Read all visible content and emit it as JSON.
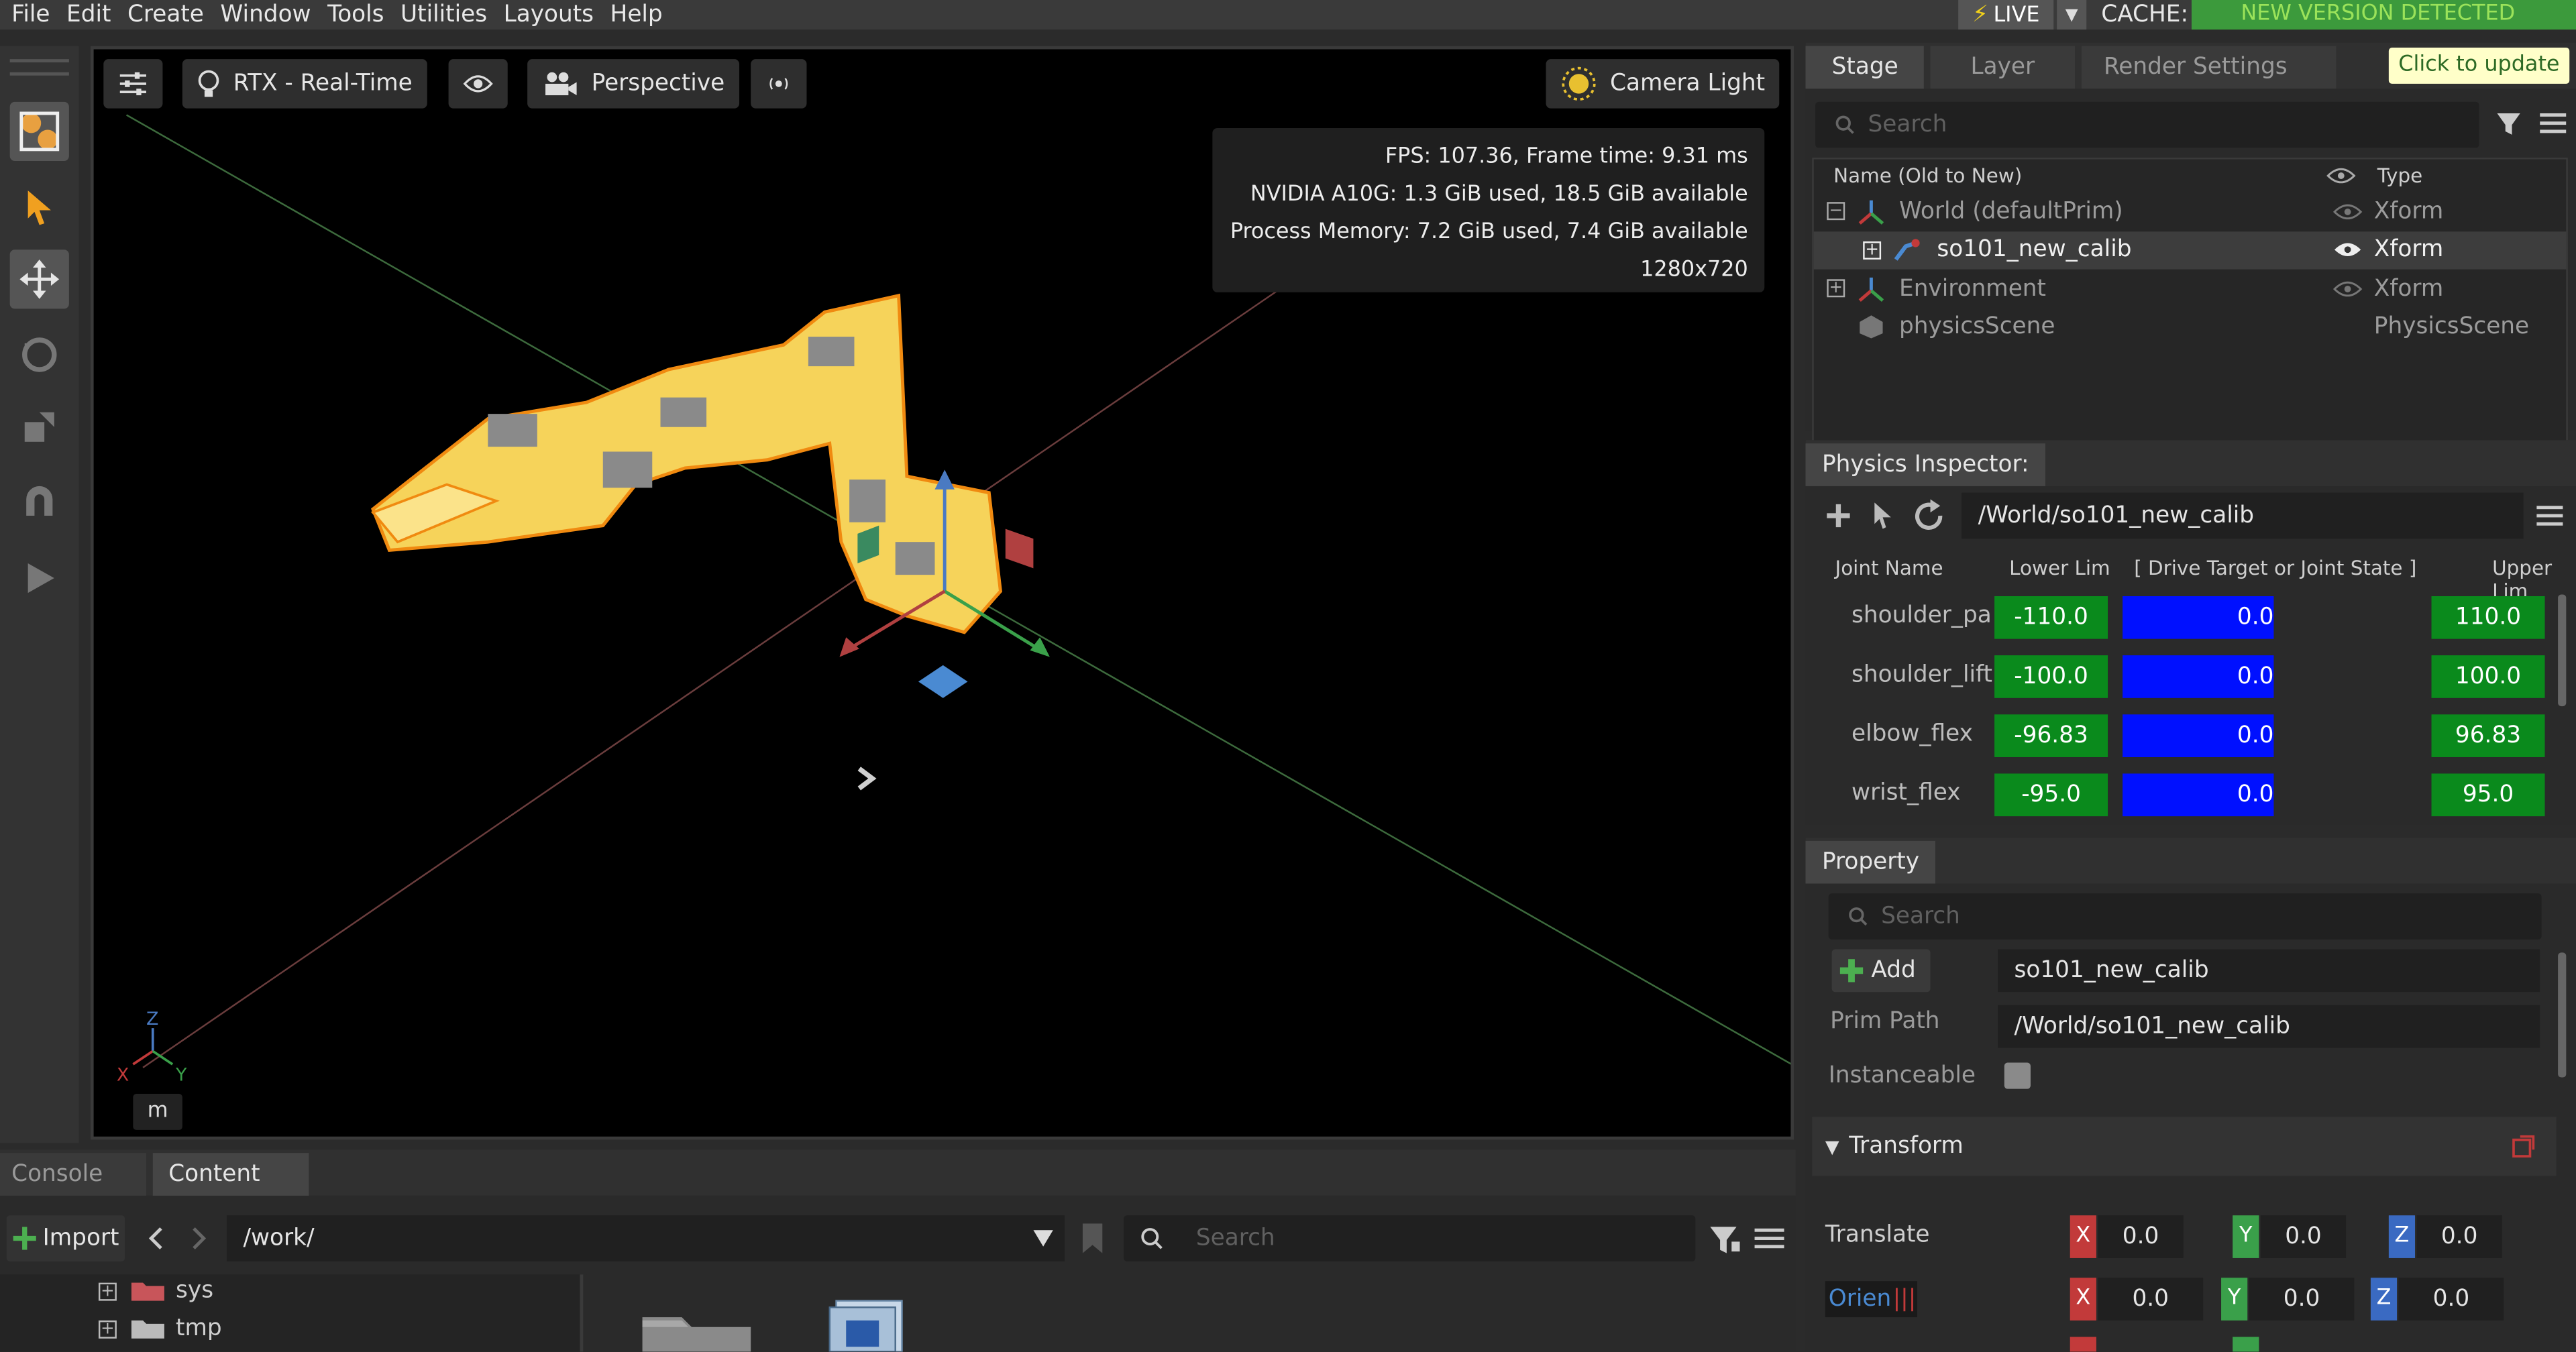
{
  "menu": [
    "File",
    "Edit",
    "Create",
    "Window",
    "Tools",
    "Utilities",
    "Layouts",
    "Help"
  ],
  "live": "LIVE",
  "cache_label": "CACHE:",
  "cache_banner": "NEW VERSION DETECTED",
  "viewport": {
    "render_mode": "RTX - Real-Time",
    "camera": "Perspective",
    "light": "Camera Light",
    "stats": [
      "FPS: 107.36, Frame time: 9.31 ms",
      "NVIDIA A10G: 1.3 GiB used, 18.5 GiB available",
      "Process Memory: 7.2 GiB used, 7.4 GiB available",
      "1280x720"
    ],
    "unit": "m",
    "axis_x": "X",
    "axis_y": "Y",
    "axis_z": "Z"
  },
  "stage": {
    "tabs": [
      "Stage",
      "Layer",
      "Render Settings"
    ],
    "update_btn": "Click to update",
    "search_placeholder": "Search",
    "col_name": "Name (Old to New)",
    "col_type": "Type",
    "rows": [
      {
        "name": "World (defaultPrim)",
        "type": "Xform"
      },
      {
        "name": "so101_new_calib",
        "type": "Xform"
      },
      {
        "name": "Environment",
        "type": "Xform"
      },
      {
        "name": "physicsScene",
        "type": "PhysicsScene"
      }
    ]
  },
  "physics": {
    "title": "Physics Inspector:",
    "path": "/World/so101_new_calib",
    "col_joint": "Joint Name",
    "col_lower": "Lower Lim",
    "col_drive": "[ Drive Target or Joint State ]",
    "col_upper": "Upper Lim",
    "joints": [
      {
        "name": "shoulder_pa",
        "lower": "-110.0",
        "value": "0.0",
        "upper": "110.0"
      },
      {
        "name": "shoulder_lift",
        "lower": "-100.0",
        "value": "0.0",
        "upper": "100.0"
      },
      {
        "name": "elbow_flex",
        "lower": "-96.83",
        "value": "0.0",
        "upper": "96.83"
      },
      {
        "name": "wrist_flex",
        "lower": "-95.0",
        "value": "0.0",
        "upper": "95.0"
      }
    ]
  },
  "property": {
    "tab": "Property",
    "search_placeholder": "Search",
    "add": "Add",
    "name_value": "so101_new_calib",
    "prim_path_label": "Prim Path",
    "prim_path_value": "/World/so101_new_calib",
    "instanceable_label": "Instanceable",
    "transform_label": "Transform",
    "translate_label": "Translate",
    "orient_label": "Orien",
    "translate": [
      "0.0",
      "0.0",
      "0.0"
    ],
    "orient": [
      "0.0",
      "0.0",
      "0.0"
    ]
  },
  "bottom": {
    "tabs": [
      "Console",
      "Content"
    ],
    "import": "Import",
    "path": "/work/",
    "search_placeholder": "Search",
    "tree": [
      "sys",
      "tmp"
    ]
  }
}
